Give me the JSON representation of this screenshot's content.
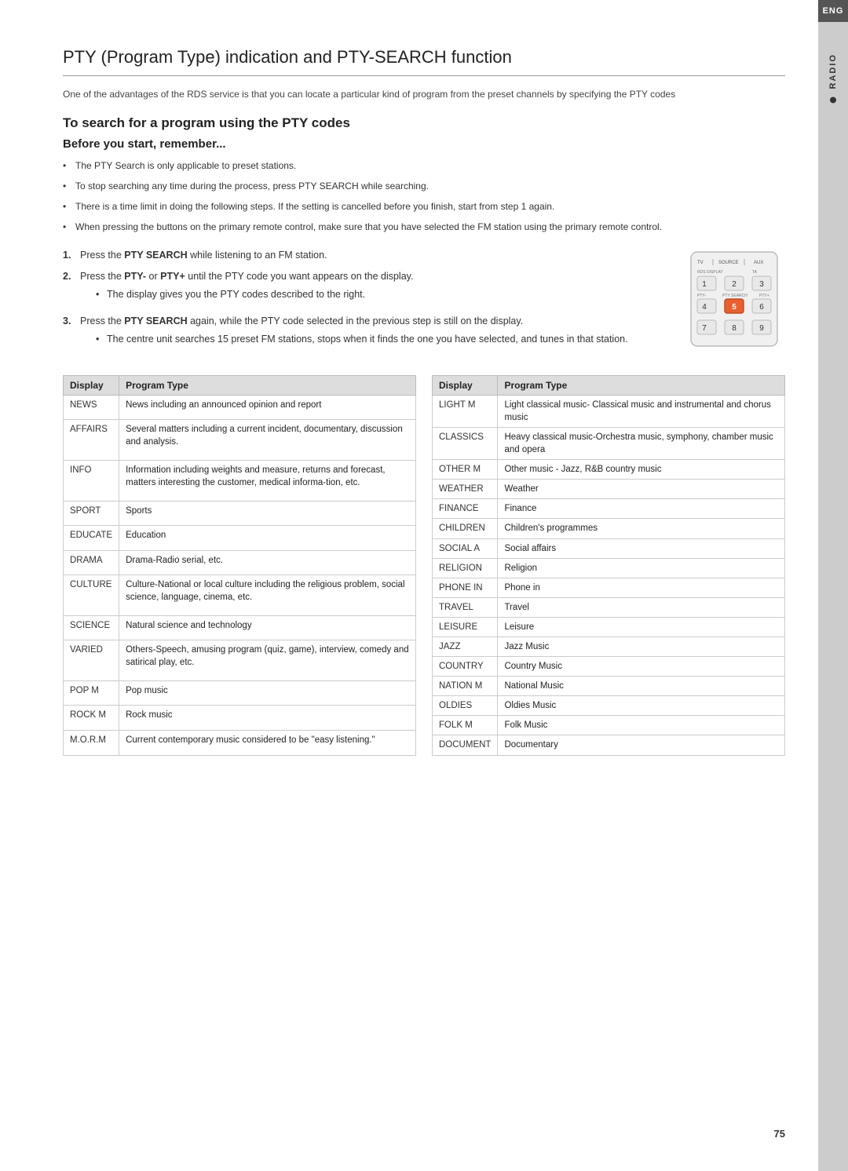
{
  "page": {
    "number": "75"
  },
  "header": {
    "title": "PTY (Program Type) indication and PTY-SEARCH function"
  },
  "intro": {
    "text": "One  of the advantages of the RDS service is that you can locate a particular kind of program from the preset channels by specifying the PTY codes"
  },
  "section1": {
    "title": "To search for a program using the PTY codes"
  },
  "section2": {
    "title": "Before you start, remember..."
  },
  "bullets": [
    "The PTY Search is only applicable to preset stations.",
    "To stop searching any time during the process, press PTY SEARCH while searching.",
    "There is a time limit in doing the following steps. If the setting is cancelled before you finish,  start from step 1 again.",
    "When pressing the buttons on the primary remote control, make sure that you have selected the FM station using the primary remote control."
  ],
  "steps": [
    {
      "num": "1.",
      "text": "Press the ",
      "bold": "PTY SEARCH",
      "rest": " while listening to an FM station.",
      "sub": []
    },
    {
      "num": "2.",
      "text": "Press the ",
      "bold": "PTY-",
      "rest": " or ",
      "bold2": "PTY+",
      "rest2": " until the PTY code you want appears on the display.",
      "sub": [
        "The display gives you the PTY codes described to the right."
      ]
    },
    {
      "num": "3.",
      "text": "Press the ",
      "bold": "PTY SEARCH",
      "rest": " again, while the PTY code selected in the previous step is still on the display.",
      "sub": [
        "The centre unit searches 15 preset FM stations, stops when it finds the one you have selected, and tunes in that station."
      ]
    }
  ],
  "table": {
    "col1_header": "Display",
    "col2_header": "Program Type",
    "col3_header": "Display",
    "col4_header": "Program Type",
    "left_rows": [
      {
        "display": "NEWS",
        "program": "News including an announced opinion and report"
      },
      {
        "display": "AFFAIRS",
        "program": "Several matters including a current incident, documentary, discussion and analysis."
      },
      {
        "display": "INFO",
        "program": "Information including weights and measure, returns and forecast, matters interesting the customer, medical informa-tion, etc."
      },
      {
        "display": "SPORT",
        "program": "Sports"
      },
      {
        "display": "EDUCATE",
        "program": "Education"
      },
      {
        "display": "DRAMA",
        "program": "Drama-Radio serial, etc."
      },
      {
        "display": "CULTURE",
        "program": "Culture-National or local culture including the religious problem, social science, language, cinema, etc."
      },
      {
        "display": "SCIENCE",
        "program": "Natural science and technology"
      },
      {
        "display": "VARIED",
        "program": "Others-Speech, amusing program (quiz, game), interview, comedy and satirical play, etc."
      },
      {
        "display": "POP M",
        "program": "Pop music"
      },
      {
        "display": "ROCK M",
        "program": "Rock music"
      },
      {
        "display": "M.O.R.M",
        "program": "Current contemporary music considered to be \"easy listening.\""
      }
    ],
    "right_rows": [
      {
        "display": "LIGHT M",
        "program": "Light classical music- Classical music and instrumental and chorus music"
      },
      {
        "display": "CLASSICS",
        "program": "Heavy classical  music-Orchestra music, symphony, chamber music and opera"
      },
      {
        "display": "OTHER M",
        "program": "Other music - Jazz, R&B country music"
      },
      {
        "display": "WEATHER",
        "program": "Weather"
      },
      {
        "display": "FINANCE",
        "program": "Finance"
      },
      {
        "display": "CHILDREN",
        "program": "Children's programmes"
      },
      {
        "display": "SOCIAL A",
        "program": "Social affairs"
      },
      {
        "display": "RELIGION",
        "program": "Religion"
      },
      {
        "display": "PHONE IN",
        "program": "Phone in"
      },
      {
        "display": "TRAVEL",
        "program": "Travel"
      },
      {
        "display": "LEISURE",
        "program": "Leisure"
      },
      {
        "display": "JAZZ",
        "program": "Jazz Music"
      },
      {
        "display": "COUNTRY",
        "program": "Country Music"
      },
      {
        "display": "NATION M",
        "program": "National Music"
      },
      {
        "display": "OLDIES",
        "program": "Oldies Music"
      },
      {
        "display": "FOLK M",
        "program": "Folk Music"
      },
      {
        "display": "DOCUMENT",
        "program": "Documentary"
      }
    ]
  },
  "side_tab": {
    "eng_label": "ENG",
    "radio_label": "RADIO"
  }
}
